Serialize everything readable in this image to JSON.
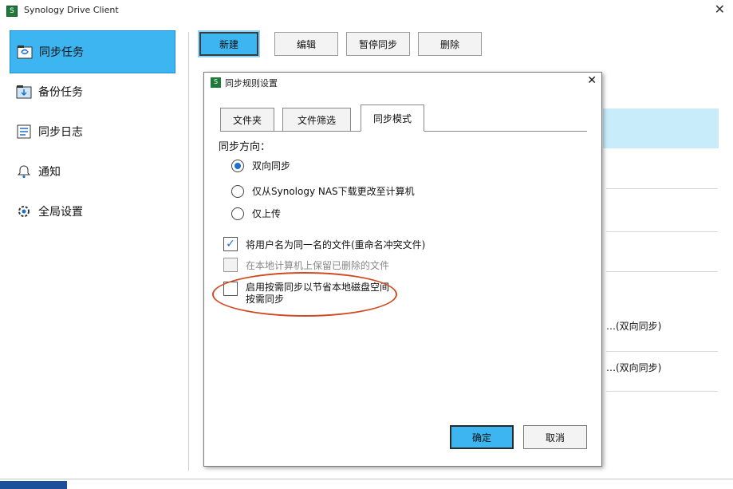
{
  "window": {
    "title": "Synology Drive Client",
    "close_symbol": "✕"
  },
  "sidebar": {
    "items": [
      {
        "label": "同步任务",
        "icon": "sync-folder-icon",
        "active": true
      },
      {
        "label": "备份任务",
        "icon": "backup-folder-icon",
        "active": false
      },
      {
        "label": "同步日志",
        "icon": "log-icon",
        "active": false
      },
      {
        "label": "通知",
        "icon": "bell-icon",
        "active": false
      },
      {
        "label": "全局设置",
        "icon": "gear-icon",
        "active": false
      }
    ]
  },
  "toolbar": {
    "buttons": [
      "新建",
      "编辑",
      "暂停同步",
      "删除"
    ]
  },
  "background_list": {
    "row1_suffix": "…(双向同步)",
    "row2_suffix": "…(双向同步)"
  },
  "dialog": {
    "title": "同步规则设置",
    "close_symbol": "✕",
    "tabs": [
      "文件夹",
      "文件筛选",
      "同步模式"
    ],
    "active_tab": 2,
    "section_label": "同步方向：",
    "radios": [
      {
        "label": "双向同步",
        "checked": true
      },
      {
        "label": "仅从Synology NAS下载更改至计算机",
        "checked": false
      },
      {
        "label": "仅上传",
        "checked": false
      }
    ],
    "checkboxes": [
      {
        "label": "将用户名为同一名的文件(重命名冲突文件)",
        "checked": true,
        "disabled": false
      },
      {
        "label": "在本地计算机上保留已删除的文件",
        "checked": false,
        "disabled": true
      },
      {
        "label": "启用按需同步以节省本地磁盘空间",
        "label_line2": "按需同步",
        "checked": false,
        "disabled": false
      }
    ],
    "ok_label": "确定",
    "cancel_label": "取消"
  },
  "colors": {
    "accent": "#3db5f0",
    "annotation": "#d04a22"
  }
}
